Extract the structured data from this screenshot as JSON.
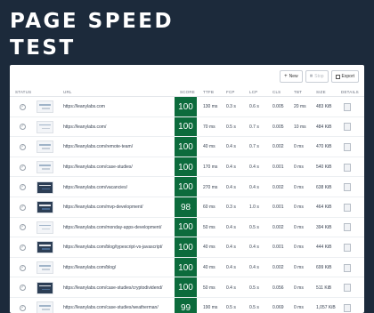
{
  "page": {
    "title_line1": "PAGE SPEED",
    "title_line2": "TEST"
  },
  "toolbar": {
    "new_label": "New",
    "stop_label": "Stop",
    "export_label": "Export"
  },
  "columns": [
    "STATUS",
    "URL",
    "SCORE",
    "TTFB",
    "FCP",
    "LCP",
    "CLS",
    "TBT",
    "SIZE",
    "DETAILS"
  ],
  "rows": [
    {
      "url": "https://leanylabs.com",
      "score": "100",
      "ttfb": "130 ms",
      "fcp": "0.3 s",
      "lcp": "0.6 s",
      "cls": "0.005",
      "tbt": "20 ms",
      "size": "483 KiB",
      "thumb": "light"
    },
    {
      "url": "https://leanylabs.com/",
      "score": "100",
      "ttfb": "70 ms",
      "fcp": "0.5 s",
      "lcp": "0.7 s",
      "cls": "0.005",
      "tbt": "10 ms",
      "size": "484 KiB",
      "thumb": "light"
    },
    {
      "url": "https://leanylabs.com/remote-team/",
      "score": "100",
      "ttfb": "40 ms",
      "fcp": "0.4 s",
      "lcp": "0.7 s",
      "cls": "0.002",
      "tbt": "0 ms",
      "size": "470 KiB",
      "thumb": "light"
    },
    {
      "url": "https://leanylabs.com/case-studies/",
      "score": "100",
      "ttfb": "170 ms",
      "fcp": "0.4 s",
      "lcp": "0.4 s",
      "cls": "0.001",
      "tbt": "0 ms",
      "size": "540 KiB",
      "thumb": "light"
    },
    {
      "url": "https://leanylabs.com/vacancies/",
      "score": "100",
      "ttfb": "270 ms",
      "fcp": "0.4 s",
      "lcp": "0.4 s",
      "cls": "0.002",
      "tbt": "0 ms",
      "size": "638 KiB",
      "thumb": "dark"
    },
    {
      "url": "https://leanylabs.com/mvp-development/",
      "score": "98",
      "ttfb": "60 ms",
      "fcp": "0.3 s",
      "lcp": "1.0 s",
      "cls": "0.001",
      "tbt": "0 ms",
      "size": "464 KiB",
      "thumb": "dark"
    },
    {
      "url": "https://leanylabs.com/monday-apps-development/",
      "score": "100",
      "ttfb": "50 ms",
      "fcp": "0.4 s",
      "lcp": "0.5 s",
      "cls": "0.002",
      "tbt": "0 ms",
      "size": "394 KiB",
      "thumb": "light"
    },
    {
      "url": "https://leanylabs.com/blog/typescript-vs-javascript/",
      "score": "100",
      "ttfb": "40 ms",
      "fcp": "0.4 s",
      "lcp": "0.4 s",
      "cls": "0.001",
      "tbt": "0 ms",
      "size": "444 KiB",
      "thumb": "dark"
    },
    {
      "url": "https://leanylabs.com/blog/",
      "score": "100",
      "ttfb": "40 ms",
      "fcp": "0.4 s",
      "lcp": "0.4 s",
      "cls": "0.002",
      "tbt": "0 ms",
      "size": "699 KiB",
      "thumb": "light"
    },
    {
      "url": "https://leanylabs.com/case-studies/cryptodividend/",
      "score": "100",
      "ttfb": "50 ms",
      "fcp": "0.4 s",
      "lcp": "0.5 s",
      "cls": "0.056",
      "tbt": "0 ms",
      "size": "511 KiB",
      "thumb": "dark"
    },
    {
      "url": "https://leanylabs.com/case-studies/weatherman/",
      "score": "99",
      "ttfb": "190 ms",
      "fcp": "0.5 s",
      "lcp": "0.5 s",
      "cls": "0.069",
      "tbt": "0 ms",
      "size": "1,057 KiB",
      "thumb": "light"
    }
  ],
  "colors": {
    "background": "#1c2a3b",
    "score_bg": "#0c6b3c",
    "score_text": "#ffffff"
  },
  "icons": {
    "status": "check-circle-icon",
    "details": "document-icon"
  }
}
